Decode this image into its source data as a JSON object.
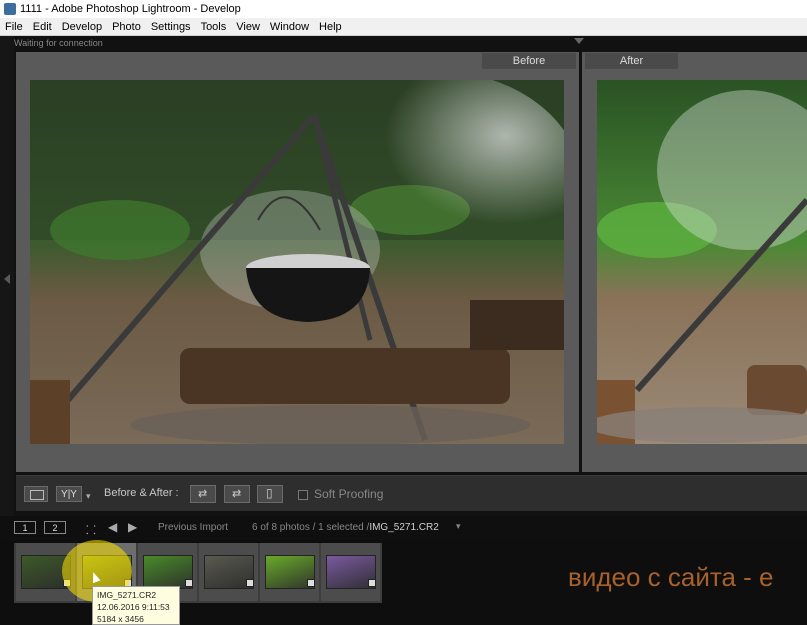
{
  "window": {
    "title": "1111 - Adobe Photoshop Lightroom - Develop"
  },
  "menu": [
    "File",
    "Edit",
    "Develop",
    "Photo",
    "Settings",
    "Tools",
    "View",
    "Window",
    "Help"
  ],
  "status": "Waiting for connection",
  "panes": {
    "before_label": "Before",
    "after_label": "After"
  },
  "toolbar": {
    "yy_label": "Y|Y",
    "before_after_label": "Before & After :",
    "soft_proofing_label": "Soft Proofing"
  },
  "filmstrip_bar": {
    "page1": "1",
    "page2": "2",
    "source": "Previous Import",
    "count_text": "6 of 8 photos / 1 selected /",
    "filename": "IMG_5271.CR2",
    "dropdown_icon": "chevron-down-icon"
  },
  "thumbnails": [
    {
      "name": "thumb-1",
      "tone": "#3d5a2a"
    },
    {
      "name": "thumb-2",
      "tone": "#8a9a2a",
      "selected": true
    },
    {
      "name": "thumb-3",
      "tone": "#4a8a2a"
    },
    {
      "name": "thumb-4",
      "tone": "#5a5a50"
    },
    {
      "name": "thumb-5",
      "tone": "#6aaa2a"
    },
    {
      "name": "thumb-6",
      "tone": "#7a5aa0"
    }
  ],
  "tooltip": {
    "filename": "IMG_5271.CR2",
    "date": "12.06.2016 9:11:53",
    "dimensions": "5184 x 3456"
  },
  "watermark": "видео с сайта - е",
  "colors": {
    "watermark": "#a8612a",
    "highlight": "#ffe600",
    "panel_gray": "#5a5a5a"
  }
}
